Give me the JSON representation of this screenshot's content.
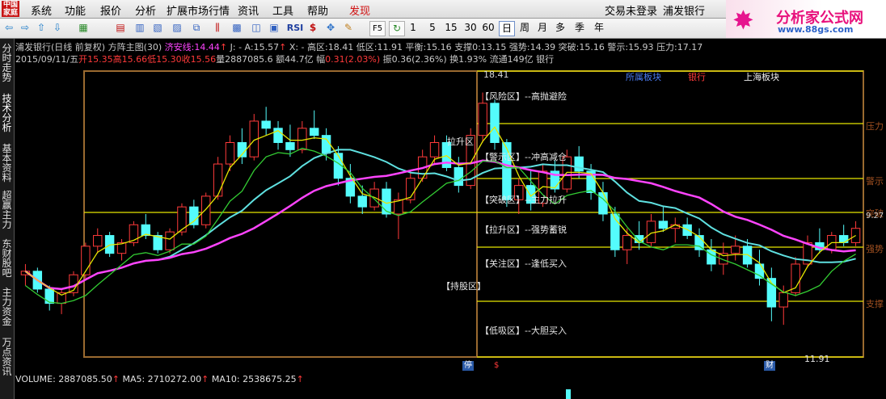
{
  "menu": {
    "logo": "中国家庭",
    "items": [
      "系统",
      "功能",
      "报价",
      "分析",
      "扩展市场行情",
      "资讯",
      "工具",
      "帮助",
      "发现"
    ],
    "right": [
      "交易未登录",
      "浦发银行"
    ]
  },
  "brand": {
    "title": "分析家公式网",
    "url": "www.88gs.com"
  },
  "toolbar": {
    "periods": [
      "1",
      "5",
      "15",
      "30",
      "60",
      "日",
      "周",
      "月",
      "多",
      "季",
      "年"
    ],
    "selected_period": "日",
    "labels": [
      "RSI",
      "F5"
    ]
  },
  "sidebar": [
    "分时走势",
    "技术分析",
    "基本资料",
    "超赢主力",
    "东财股吧",
    "主力资金",
    "万点资讯"
  ],
  "header": {
    "stock": "浦发银行(日线 前复权)",
    "indicator": "方阵主图(30)",
    "jax_label": "济安线:",
    "jax_value": "14.44",
    "j_label": "J: -",
    "a_label": "A:",
    "a_value": "15.57",
    "x_label": "X: -",
    "high_label": "高区:",
    "high_value": "18.41",
    "low_label": "低区:",
    "low_value": "11.91",
    "balance_label": "平衡:",
    "balance_value": "15.16",
    "support_label": "支撑0:",
    "support_value": "13.15",
    "strong_label": "强势:",
    "strong_value": "14.39",
    "break_label": "突破:",
    "break_value": "15.16",
    "warn_label": "警示:",
    "warn_value": "15.93",
    "press_label": "压力:",
    "press_value": "17.17"
  },
  "bar": {
    "date": "2015/09/11/五",
    "open_label": "开",
    "open": "15.35",
    "high_label": "高",
    "high": "15.66",
    "low_label": "低",
    "low": "15.30",
    "close_label": "收",
    "close": "15.56",
    "vol_label": "量",
    "vol": "2887085.6",
    "amt_label": "额",
    "amt": "44.7亿",
    "chg_label": "幅",
    "chg": "0.31(2.03%)",
    "amp_label": "振",
    "amp": "0.36(2.36%)",
    "turn_label": "换",
    "turn": "1.93%",
    "float_label": "流通",
    "float": "149亿",
    "sector": "银行"
  },
  "zones": {
    "risk": "【风险区】--高抛避险",
    "warn": "【警示区】--冲高减仓",
    "break": "【突破区】--主力拉升",
    "pull": "【拉升区】--强势蓄锐",
    "watch": "【关注区】--逢低买入",
    "hold": "【持股区】",
    "lift": "拉升区",
    "low": "【低吸区】--大胆买入",
    "top": "18.41",
    "bottom": "11.91"
  },
  "tabs": {
    "t1": "所属板块",
    "t2": "银行",
    "t3": "上海板块"
  },
  "right_labels": {
    "press": "压力",
    "warn": "警示",
    "break": "突破",
    "strong": "强势",
    "support": "支撑",
    "price": "9.27"
  },
  "flags": {
    "f1": "停",
    "f2": "$",
    "f3": "财"
  },
  "volume": {
    "text": "VOLUME: 2887085.50",
    "ma5": "MA5: 2710272.00",
    "ma10": "MA10: 2538675.25"
  },
  "colors": {
    "up": "#ff3a3a",
    "down": "#54fcfc",
    "jax": "#ff44ff",
    "line_yellow": "#e6e600",
    "cyan": "#5fe0e0",
    "green": "#33cc33",
    "frame": "#9a6a30"
  },
  "chart_data": {
    "type": "candlestick",
    "y_range": [
      11.0,
      19.0
    ],
    "candles": [
      [
        13.3,
        13.6,
        13.0,
        13.4
      ],
      [
        13.4,
        13.5,
        12.8,
        12.9
      ],
      [
        12.9,
        13.0,
        12.3,
        12.5
      ],
      [
        12.5,
        12.9,
        12.2,
        12.8
      ],
      [
        12.8,
        13.4,
        12.7,
        13.3
      ],
      [
        13.3,
        14.2,
        13.2,
        14.1
      ],
      [
        14.1,
        14.6,
        13.9,
        14.4
      ],
      [
        14.4,
        14.5,
        13.8,
        13.9
      ],
      [
        13.9,
        14.3,
        13.7,
        14.2
      ],
      [
        14.2,
        14.8,
        14.1,
        14.7
      ],
      [
        14.7,
        15.0,
        14.3,
        14.4
      ],
      [
        14.4,
        14.5,
        13.9,
        14.0
      ],
      [
        14.0,
        14.6,
        13.9,
        14.5
      ],
      [
        14.5,
        15.3,
        14.4,
        15.2
      ],
      [
        15.2,
        15.4,
        14.6,
        14.7
      ],
      [
        14.7,
        15.6,
        14.6,
        15.5
      ],
      [
        15.5,
        16.6,
        15.4,
        16.4
      ],
      [
        16.4,
        17.2,
        16.2,
        17.0
      ],
      [
        17.0,
        17.4,
        16.4,
        16.6
      ],
      [
        16.6,
        17.8,
        16.5,
        17.6
      ],
      [
        17.6,
        18.0,
        17.2,
        17.4
      ],
      [
        17.4,
        17.6,
        16.8,
        17.0
      ],
      [
        17.0,
        17.5,
        16.6,
        16.8
      ],
      [
        16.8,
        17.6,
        16.7,
        17.4
      ],
      [
        17.4,
        17.9,
        17.1,
        17.2
      ],
      [
        17.2,
        17.4,
        16.5,
        16.7
      ],
      [
        16.7,
        16.9,
        15.8,
        16.0
      ],
      [
        16.0,
        16.4,
        15.3,
        15.5
      ],
      [
        15.5,
        15.8,
        15.0,
        15.2
      ],
      [
        15.2,
        15.9,
        15.1,
        15.7
      ],
      [
        15.7,
        15.9,
        14.9,
        15.0
      ],
      [
        15.0,
        15.6,
        14.3,
        15.4
      ],
      [
        15.4,
        16.2,
        15.3,
        16.0
      ],
      [
        16.0,
        16.8,
        15.9,
        16.6
      ],
      [
        16.6,
        17.2,
        16.4,
        17.0
      ],
      [
        17.0,
        17.2,
        16.2,
        16.3
      ],
      [
        16.3,
        16.6,
        15.6,
        15.8
      ],
      [
        15.8,
        17.4,
        15.7,
        17.2
      ],
      [
        17.2,
        18.4,
        17.0,
        18.1
      ],
      [
        18.1,
        18.2,
        16.8,
        17.0
      ],
      [
        17.0,
        17.1,
        15.2,
        15.4
      ],
      [
        15.4,
        16.0,
        15.0,
        15.8
      ],
      [
        15.8,
        16.2,
        15.1,
        15.3
      ],
      [
        15.3,
        16.4,
        15.2,
        16.2
      ],
      [
        16.2,
        16.5,
        15.6,
        15.7
      ],
      [
        15.7,
        16.8,
        15.6,
        16.6
      ],
      [
        16.6,
        16.9,
        16.0,
        16.2
      ],
      [
        16.2,
        16.4,
        15.4,
        15.6
      ],
      [
        15.6,
        15.9,
        14.8,
        15.0
      ],
      [
        15.0,
        15.2,
        13.8,
        14.0
      ],
      [
        14.0,
        14.6,
        13.6,
        14.4
      ],
      [
        14.4,
        14.8,
        14.0,
        14.2
      ],
      [
        14.2,
        15.0,
        14.1,
        14.8
      ],
      [
        14.8,
        15.2,
        14.5,
        14.6
      ],
      [
        14.6,
        14.9,
        14.2,
        14.7
      ],
      [
        14.7,
        14.9,
        14.3,
        14.4
      ],
      [
        14.4,
        14.6,
        13.8,
        14.0
      ],
      [
        14.0,
        14.3,
        13.4,
        13.6
      ],
      [
        13.6,
        14.2,
        13.3,
        13.9
      ],
      [
        13.9,
        14.4,
        13.7,
        14.1
      ],
      [
        14.1,
        14.3,
        13.5,
        13.6
      ],
      [
        13.6,
        14.0,
        13.0,
        13.2
      ],
      [
        13.2,
        13.5,
        12.0,
        12.4
      ],
      [
        12.4,
        13.0,
        11.9,
        12.8
      ],
      [
        12.8,
        13.8,
        12.7,
        13.6
      ],
      [
        13.6,
        14.4,
        13.5,
        14.2
      ],
      [
        14.2,
        14.6,
        13.9,
        14.0
      ],
      [
        14.0,
        14.5,
        13.9,
        14.4
      ],
      [
        14.4,
        14.7,
        14.1,
        14.2
      ],
      [
        14.2,
        14.8,
        14.1,
        14.6
      ]
    ]
  }
}
